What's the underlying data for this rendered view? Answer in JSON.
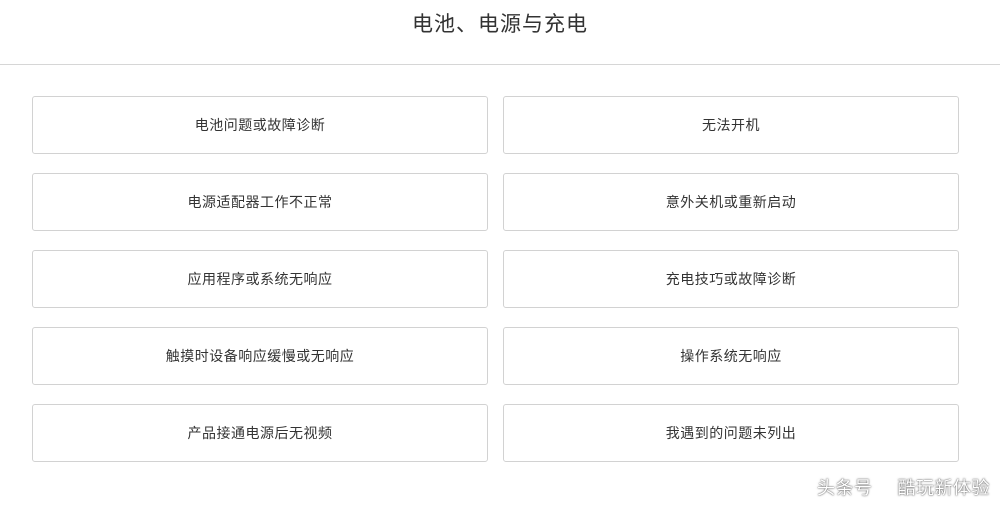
{
  "header": {
    "title": "电池、电源与充电"
  },
  "options": [
    {
      "label": "电池问题或故障诊断"
    },
    {
      "label": "无法开机"
    },
    {
      "label": "电源适配器工作不正常"
    },
    {
      "label": "意外关机或重新启动"
    },
    {
      "label": "应用程序或系统无响应"
    },
    {
      "label": "充电技巧或故障诊断"
    },
    {
      "label": "触摸时设备响应缓慢或无响应"
    },
    {
      "label": "操作系统无响应"
    },
    {
      "label": "产品接通电源后无视频"
    },
    {
      "label": "我遇到的问题未列出"
    }
  ],
  "watermark": {
    "prefix": "头条号",
    "name": "酷玩新体验",
    "icon": "slash-logo-icon"
  }
}
